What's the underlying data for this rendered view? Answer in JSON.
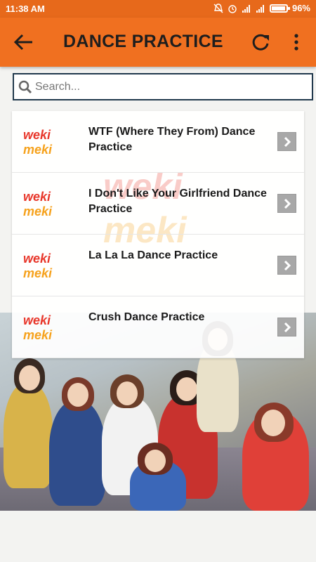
{
  "status_bar": {
    "time": "11:38 AM",
    "battery": "96%",
    "battery_level": 0.96,
    "icons": [
      "mute-icon",
      "alarm-icon",
      "signal-icon",
      "signal-icon",
      "battery-icon"
    ]
  },
  "app_bar": {
    "title": "DANCE PRACTICE",
    "back_icon": "back-arrow-icon",
    "refresh_icon": "refresh-icon",
    "menu_icon": "more-vert-icon"
  },
  "search": {
    "placeholder": "Search...",
    "value": ""
  },
  "list": {
    "items": [
      {
        "label": "WTF (Where They From) Dance Practice",
        "logo": "WEKI MEKI"
      },
      {
        "label": "I Don't Like Your Girlfriend Dance Practice",
        "logo": "WEKI MEKI"
      },
      {
        "label": "La La La Dance Practice",
        "logo": "WEKI MEKI"
      },
      {
        "label": "Crush Dance Practice",
        "logo": "WEKI MEKI"
      }
    ]
  },
  "colors": {
    "status_bar": "#e7691b",
    "app_bar": "#f07020",
    "logo_red": "#e8372b",
    "logo_orange": "#f6a21d",
    "search_border": "#21394d",
    "arrow_button": "#a8a8a8"
  }
}
